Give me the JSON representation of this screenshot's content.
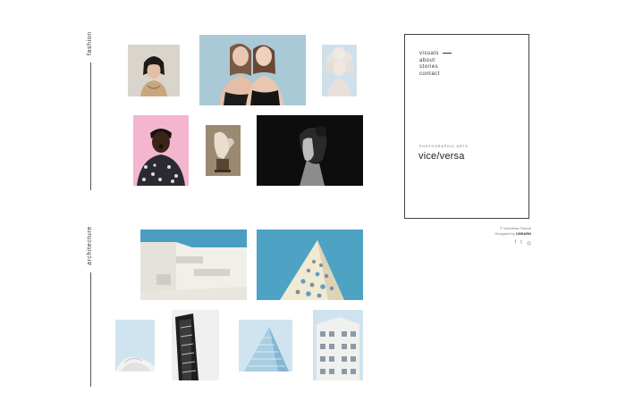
{
  "sections": {
    "fashion": {
      "label": "fashion"
    },
    "architecture": {
      "label": "architecture"
    }
  },
  "nav": {
    "items": [
      {
        "label": "visuals"
      },
      {
        "label": "about"
      },
      {
        "label": "stories"
      },
      {
        "label": "contact"
      }
    ]
  },
  "brand": {
    "tagline": "PHOTOGRAPHIC ARTS",
    "name": "vice/versa"
  },
  "footer": {
    "copyright": "© Viceversa Theme",
    "designed_prefix": "Designed by",
    "designer": "UXBARN"
  },
  "social": {
    "icons": [
      {
        "name": "facebook-icon",
        "glyph": "f"
      },
      {
        "name": "twitter-icon",
        "glyph": "t"
      },
      {
        "name": "instagram-icon",
        "glyph": "◎"
      }
    ]
  },
  "colors": {
    "accent_sky": "#4a9ec2",
    "pink_backdrop": "#f4b6cf",
    "panel_border": "#444444"
  }
}
